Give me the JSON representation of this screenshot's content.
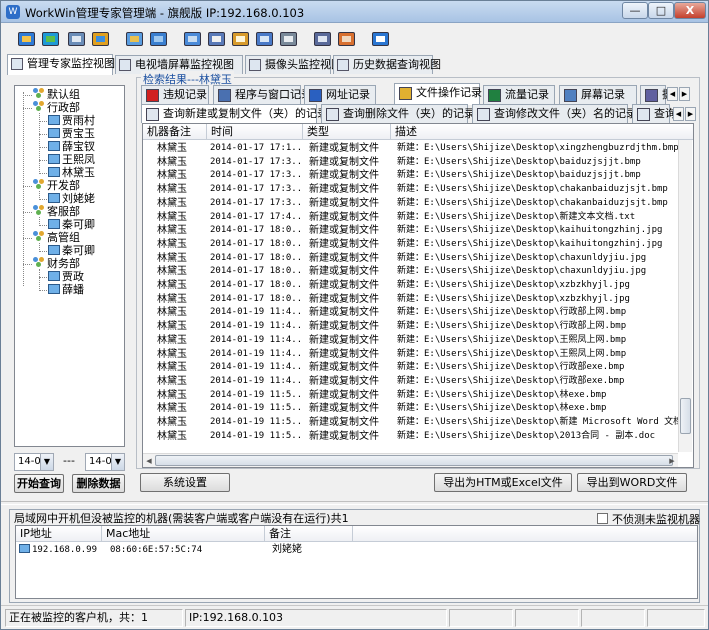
{
  "window": {
    "title": "WorkWin管理专家管理端 - 旗舰版 IP:192.168.0.103",
    "min_label": "—",
    "max_label": "□",
    "close_label": "X"
  },
  "toolbar": {
    "icons": [
      "computers-icon",
      "globe-icon",
      "monitor-settings-icon",
      "users-icon",
      "network-icon",
      "info-icon",
      "screen-icon",
      "email-icon",
      "document-icon",
      "windows-icon",
      "disc-icon",
      "report-icon",
      "person-icon",
      "help-icon"
    ]
  },
  "view_tabs": [
    "管理专家监控视图",
    "电视墙屏幕监控视图",
    "摄像头监控视图",
    "历史数据查询视图"
  ],
  "tree": {
    "groups": [
      {
        "name": "默认组",
        "members": []
      },
      {
        "name": "行政部",
        "members": [
          "贾雨村",
          "贾宝玉",
          "薛宝钗",
          "王熙凤",
          "林黛玉"
        ]
      },
      {
        "name": "开发部",
        "members": [
          "刘姥姥"
        ]
      },
      {
        "name": "客服部",
        "members": [
          "秦可卿"
        ]
      },
      {
        "name": "高管组",
        "members": [
          "秦可卿"
        ]
      },
      {
        "name": "财务部",
        "members": [
          "贾政",
          "薛蟠"
        ]
      }
    ]
  },
  "filters": {
    "from_value": "14-0",
    "separator": "---",
    "to_value": "14-0"
  },
  "buttons": {
    "start_query": "开始查询",
    "delete_data": "删除数据",
    "system_settings": "系统设置",
    "export_html": "导出为HTM或Excel文件",
    "export_word": "导出到WORD文件"
  },
  "result_title": "检索结果---林黛玉",
  "record_tabs": [
    "违规记录",
    "程序与窗口记录",
    "网址记录",
    "文件操作记录",
    "流量记录",
    "屏幕记录",
    "摄"
  ],
  "file_tabs": [
    "查询新建或复制文件（夹）的记录",
    "查询删除文件（夹）的记录",
    "查询修改文件（夹）名的记录",
    "查询"
  ],
  "grid": {
    "columns": [
      "机器备注",
      "时间",
      "类型",
      "描述"
    ],
    "rows": [
      [
        "林黛玉",
        "2014-01-17 17:1...",
        "新建或复制文件",
        "新建：E:\\Users\\Shijize\\Desktop\\xingzhengbuzrdjthm.bmp"
      ],
      [
        "林黛玉",
        "2014-01-17 17:3...",
        "新建或复制文件",
        "新建：E:\\Users\\Shijize\\Desktop\\baiduzjsjjt.bmp"
      ],
      [
        "林黛玉",
        "2014-01-17 17:3...",
        "新建或复制文件",
        "新建：E:\\Users\\Shijize\\Desktop\\baiduzjsjjt.bmp"
      ],
      [
        "林黛玉",
        "2014-01-17 17:3...",
        "新建或复制文件",
        "新建：E:\\Users\\Shijize\\Desktop\\chakanbaiduzjsjt.bmp"
      ],
      [
        "林黛玉",
        "2014-01-17 17:3...",
        "新建或复制文件",
        "新建：E:\\Users\\Shijize\\Desktop\\chakanbaiduzjsjt.bmp"
      ],
      [
        "林黛玉",
        "2014-01-17 17:4...",
        "新建或复制文件",
        "新建：E:\\Users\\Shijize\\Desktop\\新建文本文档.txt"
      ],
      [
        "林黛玉",
        "2014-01-17 18:0...",
        "新建或复制文件",
        "新建：E:\\Users\\Shijize\\Desktop\\kaihuitongzhinj.jpg"
      ],
      [
        "林黛玉",
        "2014-01-17 18:0...",
        "新建或复制文件",
        "新建：E:\\Users\\Shijize\\Desktop\\kaihuitongzhinj.jpg"
      ],
      [
        "林黛玉",
        "2014-01-17 18:0...",
        "新建或复制文件",
        "新建：E:\\Users\\Shijize\\Desktop\\chaxunldyjiu.jpg"
      ],
      [
        "林黛玉",
        "2014-01-17 18:0...",
        "新建或复制文件",
        "新建：E:\\Users\\Shijize\\Desktop\\chaxunldyjiu.jpg"
      ],
      [
        "林黛玉",
        "2014-01-17 18:0...",
        "新建或复制文件",
        "新建：E:\\Users\\Shijize\\Desktop\\xzbzkhyjl.jpg"
      ],
      [
        "林黛玉",
        "2014-01-17 18:0...",
        "新建或复制文件",
        "新建：E:\\Users\\Shijize\\Desktop\\xzbzkhyjl.jpg"
      ],
      [
        "林黛玉",
        "2014-01-19 11:4...",
        "新建或复制文件",
        "新建：E:\\Users\\Shijize\\Desktop\\行政部上网.bmp"
      ],
      [
        "林黛玉",
        "2014-01-19 11:4...",
        "新建或复制文件",
        "新建：E:\\Users\\Shijize\\Desktop\\行政部上网.bmp"
      ],
      [
        "林黛玉",
        "2014-01-19 11:4...",
        "新建或复制文件",
        "新建：E:\\Users\\Shijize\\Desktop\\王熙凤上网.bmp"
      ],
      [
        "林黛玉",
        "2014-01-19 11:4...",
        "新建或复制文件",
        "新建：E:\\Users\\Shijize\\Desktop\\王熙凤上网.bmp"
      ],
      [
        "林黛玉",
        "2014-01-19 11:4...",
        "新建或复制文件",
        "新建：E:\\Users\\Shijize\\Desktop\\行政部exe.bmp"
      ],
      [
        "林黛玉",
        "2014-01-19 11:4...",
        "新建或复制文件",
        "新建：E:\\Users\\Shijize\\Desktop\\行政部exe.bmp"
      ],
      [
        "林黛玉",
        "2014-01-19 11:5...",
        "新建或复制文件",
        "新建：E:\\Users\\Shijize\\Desktop\\林exe.bmp"
      ],
      [
        "林黛玉",
        "2014-01-19 11:5...",
        "新建或复制文件",
        "新建：E:\\Users\\Shijize\\Desktop\\林exe.bmp"
      ],
      [
        "林黛玉",
        "2014-01-19 11:5...",
        "新建或复制文件",
        "新建：E:\\Users\\Shijize\\Desktop\\新建 Microsoft Word 文档.doc"
      ],
      [
        "林黛玉",
        "2014-01-19 11:5...",
        "新建或复制文件",
        "新建：E:\\Users\\Shijize\\Desktop\\2013合同 - 副本.doc"
      ]
    ]
  },
  "lan_panel": {
    "title": "局域网中开机但没被监控的机器(需装客户端或客户端没有在运行)共1",
    "checkbox_label": "不侦测未监视机器",
    "columns": [
      "IP地址",
      "Mac地址",
      "备注"
    ],
    "rows": [
      [
        "192.168.0.99",
        "08:60:6E:57:5C:74",
        "刘姥姥"
      ]
    ]
  },
  "statusbar": {
    "left": "正在被监控的客户机，共：1",
    "right": "IP:192.168.0.103"
  }
}
